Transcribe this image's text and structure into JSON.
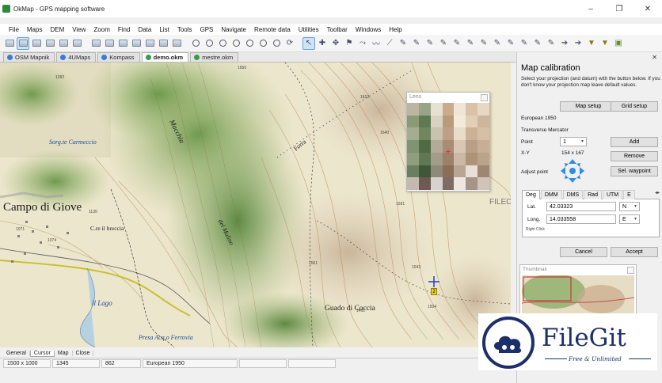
{
  "window": {
    "title": "OkMap - GPS mapping software",
    "minimize_label": "–",
    "maximize_label": "❐",
    "close_label": "✕"
  },
  "menu": [
    "File",
    "Maps",
    "DEM",
    "View",
    "Zoom",
    "Find",
    "Data",
    "List",
    "Tools",
    "GPS",
    "Navigate",
    "Remote data",
    "Utilities",
    "Toolbar",
    "Windows",
    "Help"
  ],
  "tabs": [
    {
      "label": "OSM Mapnik",
      "selected": false
    },
    {
      "label": "4UMaps",
      "selected": false
    },
    {
      "label": "Kompass",
      "selected": false
    },
    {
      "label": "demo.okm",
      "selected": true
    },
    {
      "label": "mestre.okm",
      "selected": false
    }
  ],
  "map": {
    "labels": {
      "campo": "Campo di Giove",
      "sorg": "Sorg.te Carmeccio",
      "lago": "il Lago",
      "breccia": "C.re il breccia",
      "macchia": "Macchia",
      "mulino": "del Mulino",
      "forra": "Forra",
      "coccia": "Guado di Coccia",
      "presa": "Presa Acq.o Ferrovia",
      "watermark": "FILECR"
    },
    "waypoint_label": "2"
  },
  "lens": {
    "title": "Lens",
    "crosshair": "+",
    "pixel_colors": [
      "#bcb6a0",
      "#9aa28a",
      "#e6e2d2",
      "#c9ab8e",
      "#f0e6d6",
      "#d8c3a8",
      "#e7d7c3",
      "#8a9a74",
      "#5e7a52",
      "#d9d2c0",
      "#b89a7c",
      "#f3eadb",
      "#e2cfb8",
      "#cdb79c",
      "#a3ad8f",
      "#6f8660",
      "#c9c2ae",
      "#bda085",
      "#e9dccb",
      "#cbb297",
      "#d5c0a5",
      "#7f9470",
      "#4f6a45",
      "#b2ab98",
      "#a98d72",
      "#d8c7b3",
      "#b99f85",
      "#c7ae95",
      "#8f9f7e",
      "#5f7854",
      "#a39c89",
      "#9c8168",
      "#cbb9a5",
      "#ad9378",
      "#bba38a",
      "#6a7f5e",
      "#3f5638",
      "#8f8a78",
      "#8a6e58",
      "#b8a692",
      "#e8e0d8",
      "#9f8670",
      "#c4b9b0",
      "#6c5a55",
      "#d9d1cc",
      "#7d6c66",
      "#ede7e2",
      "#a6938a",
      "#d2c3ba"
    ]
  },
  "bottom_tabs": [
    {
      "label": "General",
      "selected": false
    },
    {
      "label": "Cursor",
      "selected": true
    },
    {
      "label": "Map",
      "selected": false
    },
    {
      "label": "Close",
      "selected": false
    }
  ],
  "status": [
    "1500 x 1000",
    "1345",
    "862",
    "European 1950"
  ],
  "panel": {
    "title": "Map calibration",
    "close": "✕",
    "description": "Select your projection (and datum) with the button below. If you don't know your projection map leave default values.",
    "map_setup": "Map setup",
    "grid_setup": "Grid setup",
    "datum": "European 1950",
    "projection": "Transverse Mercator",
    "point_label": "Point",
    "point_value": "1",
    "add": "Add",
    "xy_label": "X-Y",
    "xy_value": "154 x 167",
    "remove": "Remove",
    "adjust_label": "Adjust point",
    "sel_waypoint": "Sel. waypoint",
    "coord_tabs": [
      {
        "label": "Deg",
        "selected": true
      },
      {
        "label": "DMM",
        "selected": false
      },
      {
        "label": "DMS",
        "selected": false
      },
      {
        "label": "Rad",
        "selected": false
      },
      {
        "label": "UTM",
        "selected": false
      },
      {
        "label": "E",
        "selected": false
      }
    ],
    "tab_arrows": "◂▸",
    "lat_label": "Lat.",
    "lat_value": "42.03323",
    "lat_dir": "N",
    "long_label": "Long.",
    "long_value": "14.033558",
    "long_dir": "E",
    "right_click": "Right Click",
    "cancel": "Cancel",
    "accept": "Accept",
    "thumbnail_title": "Thumbnail"
  },
  "watermark": {
    "brand": "FileGit",
    "tagline": "Free & Unlimited"
  },
  "colors": {
    "accent": "#1c2f6b",
    "selected_tab": "#ffffff",
    "toolbar_active": "#cfe3f7"
  }
}
